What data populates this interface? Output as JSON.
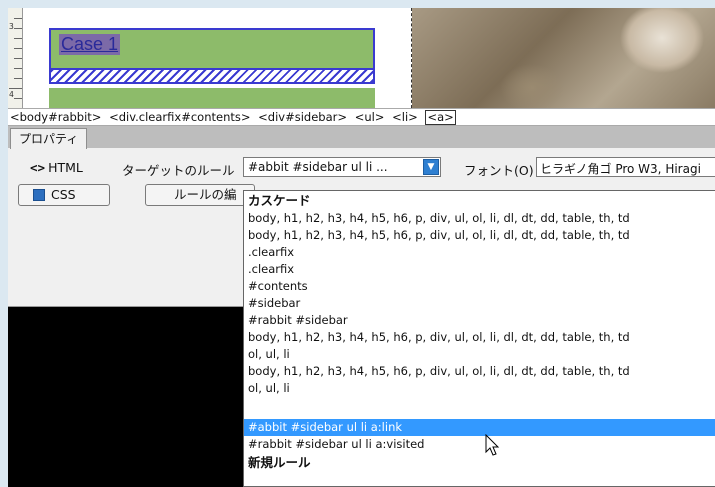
{
  "design": {
    "case_label": "Case 1",
    "ruler_numbers": [
      "3",
      "4"
    ]
  },
  "tag_selector": {
    "tags": [
      "<body#rabbit>",
      "<div.clearfix#contents>",
      "<div#sidebar>",
      "<ul>",
      "<li>",
      "<a>"
    ],
    "active_index": 5
  },
  "properties": {
    "tab_label": "プロパティ",
    "html_button": "HTML",
    "target_rule_label": "ターゲットのルール",
    "target_rule_value": "#abbit #sidebar ul li ...",
    "font_label": "フォント(O)",
    "font_value": "ヒラギノ角ゴ Pro W3, Hiragi",
    "css_button": "CSS",
    "edit_rule_button": "ルールの編"
  },
  "dropdown": {
    "items": [
      {
        "text": "カスケード",
        "kind": "header"
      },
      {
        "text": "body, h1, h2, h3, h4, h5, h6, p, div, ul, ol, li, dl, dt, dd, table, th, td",
        "kind": "item"
      },
      {
        "text": "body, h1, h2, h3, h4, h5, h6, p, div, ul, ol, li, dl, dt, dd, table, th, td",
        "kind": "item"
      },
      {
        "text": ".clearfix",
        "kind": "item"
      },
      {
        "text": ".clearfix",
        "kind": "item"
      },
      {
        "text": "#contents",
        "kind": "item"
      },
      {
        "text": "#sidebar",
        "kind": "item"
      },
      {
        "text": "#rabbit #sidebar",
        "kind": "item"
      },
      {
        "text": "body, h1, h2, h3, h4, h5, h6, p, div, ul, ol, li, dl, dt, dd, table, th, td",
        "kind": "item"
      },
      {
        "text": "ol, ul, li",
        "kind": "item"
      },
      {
        "text": "body, h1, h2, h3, h4, h5, h6, p, div, ul, ol, li, dl, dt, dd, table, th, td",
        "kind": "item"
      },
      {
        "text": "ol, ul, li",
        "kind": "item"
      },
      {
        "text": "#abbit #sidebar ul li a:link",
        "kind": "selected"
      },
      {
        "text": "#rabbit #sidebar ul li a:visited",
        "kind": "item"
      },
      {
        "text": "新規ルール",
        "kind": "header"
      }
    ]
  },
  "colors": {
    "selection": "#3399ff",
    "case_fill": "#8dbb6a",
    "dropdown_arrow": "#2e7fd1"
  }
}
